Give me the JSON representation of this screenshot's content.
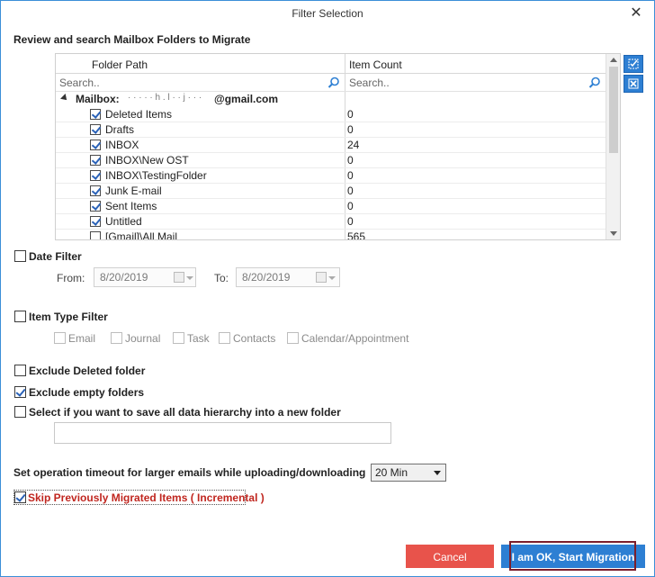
{
  "window": {
    "title": "Filter Selection",
    "close_glyph": "✕"
  },
  "heading": "Review and search Mailbox Folders to Migrate",
  "grid": {
    "columns": {
      "folder_path": "Folder Path",
      "item_count": "Item Count"
    },
    "search_placeholder_path": "Search..",
    "search_placeholder_count": "Search..",
    "mailbox_label": "Mailbox:",
    "mailbox_email_masked": "· · · · · h . l · · j · · ·",
    "mailbox_email_suffix": "@gmail.com",
    "rows": [
      {
        "name": "Deleted Items",
        "count": "0",
        "checked": true
      },
      {
        "name": "Drafts",
        "count": "0",
        "checked": true
      },
      {
        "name": "INBOX",
        "count": "24",
        "checked": true
      },
      {
        "name": "INBOX\\New OST",
        "count": "0",
        "checked": true
      },
      {
        "name": "INBOX\\TestingFolder",
        "count": "0",
        "checked": true
      },
      {
        "name": "Junk E-mail",
        "count": "0",
        "checked": true
      },
      {
        "name": "Sent Items",
        "count": "0",
        "checked": true
      },
      {
        "name": "Untitled",
        "count": "0",
        "checked": true
      },
      {
        "name": "[Gmail]\\All Mail",
        "count": "565",
        "checked": false
      }
    ]
  },
  "date_filter": {
    "label": "Date Filter",
    "from_label": "From:",
    "from_value": "8/20/2019",
    "to_label": "To:",
    "to_value": "8/20/2019"
  },
  "item_type_filter": {
    "label": "Item Type Filter",
    "types": [
      "Email",
      "Journal",
      "Task",
      "Contacts",
      "Calendar/Appointment"
    ]
  },
  "options": {
    "exclude_deleted": "Exclude Deleted folder",
    "exclude_empty": "Exclude empty folders",
    "save_hierarchy": "Select if you want to save all data hierarchy into a new folder"
  },
  "timeout": {
    "label": "Set operation timeout for larger emails while uploading/downloading",
    "value": "20 Min"
  },
  "incremental": {
    "label": "Skip Previously Migrated Items ( Incremental )"
  },
  "buttons": {
    "cancel": "Cancel",
    "start": "I am OK, Start Migration"
  },
  "colors": {
    "accent": "#2d7fd3",
    "cancel": "#e8534b",
    "incremental_text": "#c0261f",
    "highlight": "#7b1e2b"
  }
}
